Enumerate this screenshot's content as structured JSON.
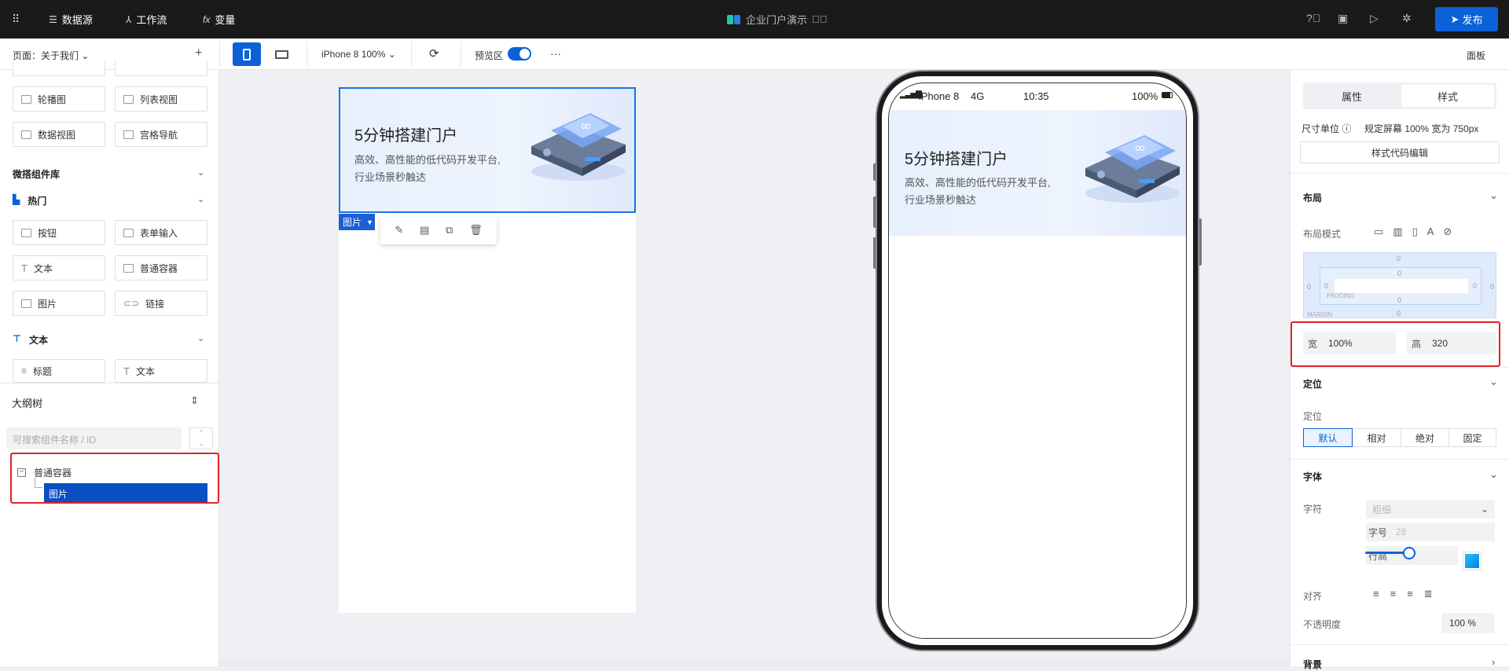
{
  "topbar": {
    "nav": [
      "数据源",
      "工作流",
      "变量"
    ],
    "app_title": "企业门户演示",
    "publish_label": "发布"
  },
  "toolbar": {
    "page_selector": "页面：关于我们",
    "device_label": "iPhone 8 100%",
    "preview_label": "预览区",
    "more": "···",
    "panel_label": "面板"
  },
  "left_panel": {
    "components_top": [
      "轮播图",
      "列表视图",
      "数据视图",
      "宫格导航"
    ],
    "micro_library_title": "微搭组件库",
    "hot_title": "热门",
    "hot_items": [
      "按钮",
      "表单输入",
      "文本",
      "普通容器",
      "图片",
      "链接"
    ],
    "text_title": "文本",
    "text_items": [
      "标题",
      "文本"
    ],
    "outline_title": "大纲树",
    "search_placeholder": "可搜索组件名称 / ID",
    "tree": {
      "container": "普通容器",
      "image": "图片"
    }
  },
  "canvas": {
    "banner_title": "5分钟搭建门户",
    "banner_subtitle": "高效、高性能的低代码开发平台,\n行业场景秒触达",
    "selected_tag": "图片"
  },
  "phone": {
    "carrier": "iPhone 8",
    "network": "4G",
    "time": "10:35",
    "battery": "100%",
    "banner_title": "5分钟搭建门户",
    "banner_subtitle": "高效、高性能的低代码开发平台,\n行业场景秒触达"
  },
  "right_panel": {
    "tabs": [
      "属性",
      "样式"
    ],
    "unit_label": "尺寸单位",
    "unit_value": "规定屏幕 100% 宽为 750px",
    "style_code_btn": "样式代码编辑",
    "layout_title": "布局",
    "layout_mode_label": "布局模式",
    "box_padding": "PADDING",
    "box_margin": "MARGIN",
    "box_zero": "0",
    "width_key": "宽",
    "width_value": "100%",
    "height_key": "高",
    "height_value": "320",
    "position_title": "定位",
    "position_label": "定位",
    "position_options": [
      "默认",
      "相对",
      "绝对",
      "固定"
    ],
    "font_title": "字体",
    "font_family_label": "字符",
    "font_weight_placeholder": "粗细",
    "font_size_key": "字号",
    "font_size_value": "28",
    "line_height_key": "行高",
    "align_label": "对齐",
    "opacity_label": "不透明度",
    "opacity_value": "100 %",
    "background_title": "背景"
  },
  "colors": {
    "accent": "#0a62d6",
    "highlight": "#e02424",
    "topbar": "#1a1a1a"
  }
}
